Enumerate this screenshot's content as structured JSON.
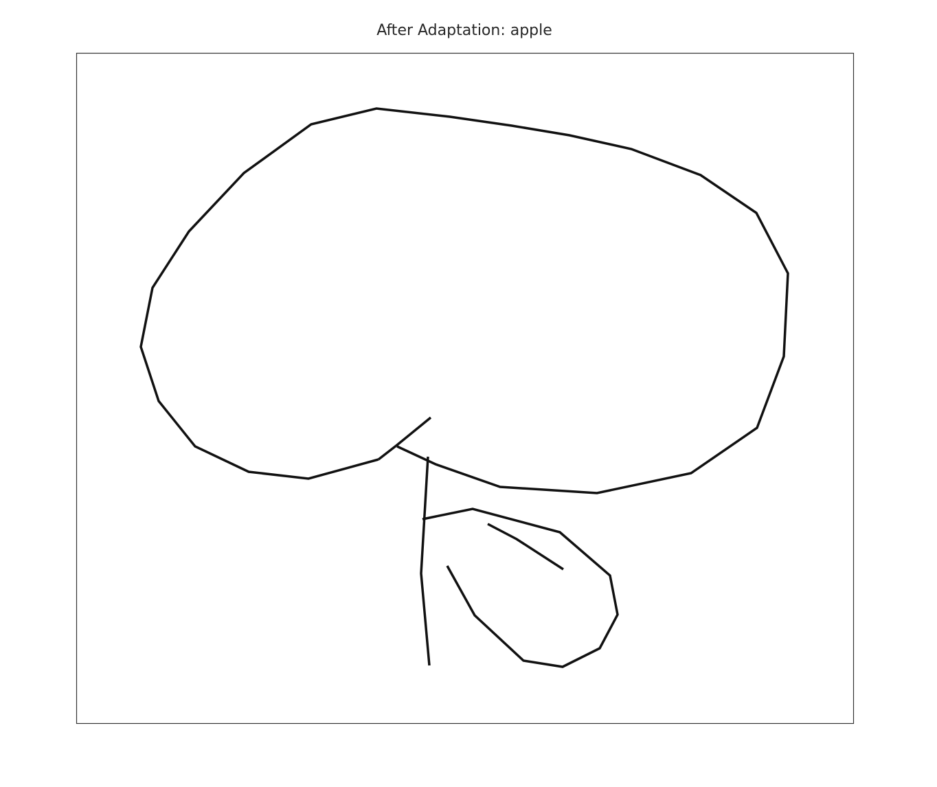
{
  "figure": {
    "title": "After Adaptation: apple",
    "stroke_color": "#000000",
    "frame_color": "#333333",
    "background": "#ffffff"
  }
}
